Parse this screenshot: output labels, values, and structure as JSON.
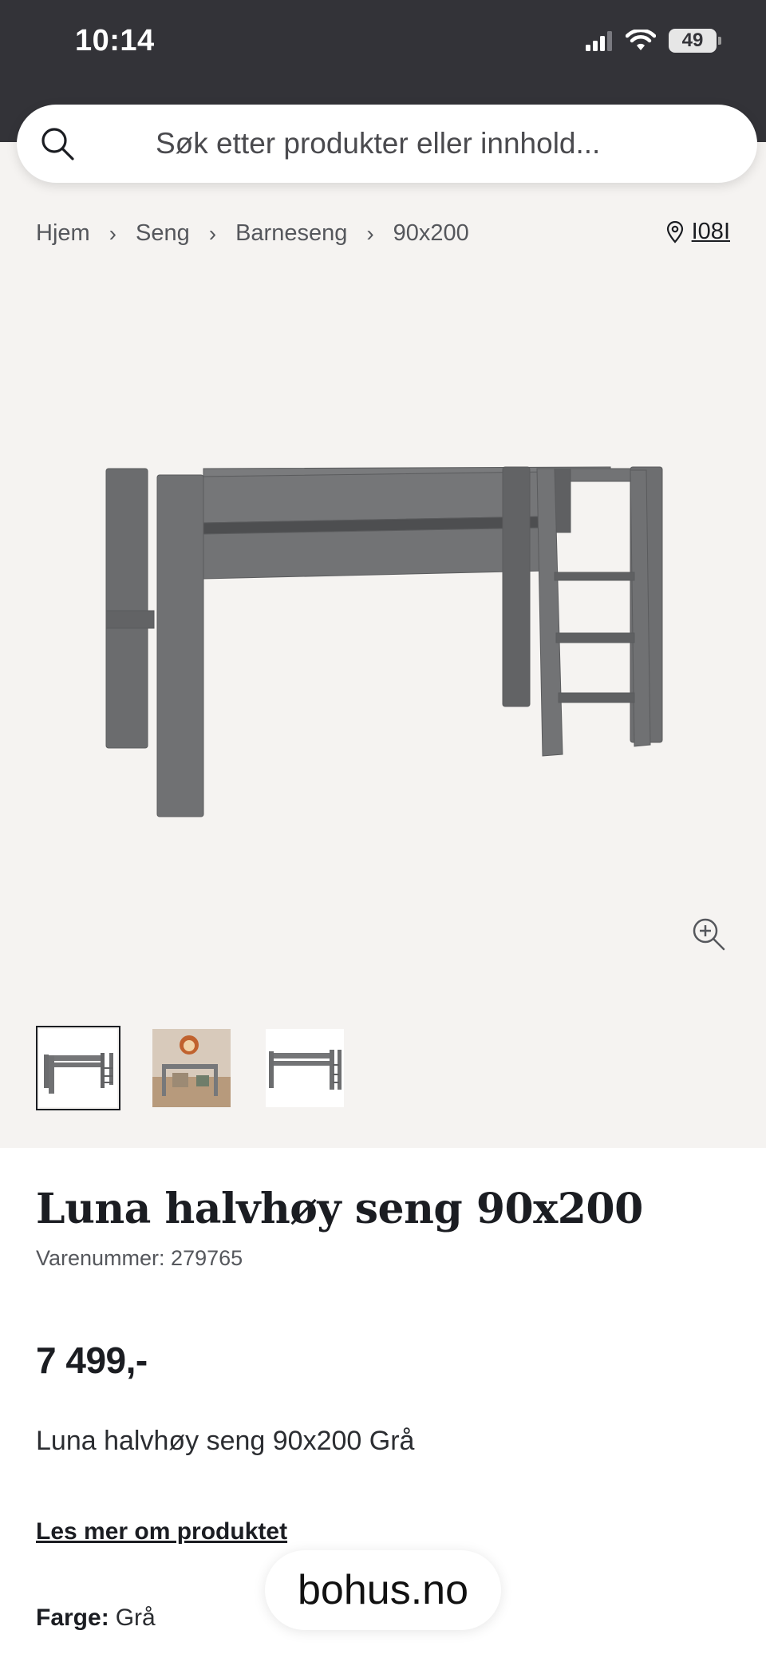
{
  "status_bar": {
    "time": "10:14",
    "battery": "49",
    "icons": [
      "signal-icon",
      "wifi-icon",
      "battery-icon"
    ]
  },
  "search": {
    "placeholder": "Søk etter produkter eller innhold..."
  },
  "breadcrumb": [
    "Hjem",
    "Seng",
    "Barneseng",
    "90x200"
  ],
  "store": {
    "label": "I08I"
  },
  "product": {
    "title": "Luna halvhøy seng 90x200",
    "sku": "Varenummer: 279765",
    "price": "7 499,-",
    "short_description": "Luna halvhøy seng 90x200 Grå",
    "read_more": "Les mer om produktet",
    "color_label": "Farge:",
    "color_value": "Grå"
  },
  "gallery": {
    "thumbnails": [
      "bed-front",
      "bed-room-scene",
      "bed-side"
    ],
    "active_index": 0
  },
  "browser": {
    "domain": "bohus.no"
  },
  "colors": {
    "status_bar": "#333338",
    "page_gray": "#f5f3f1",
    "bed_gray": "#6b6c6e",
    "text": "#1b1d22"
  }
}
